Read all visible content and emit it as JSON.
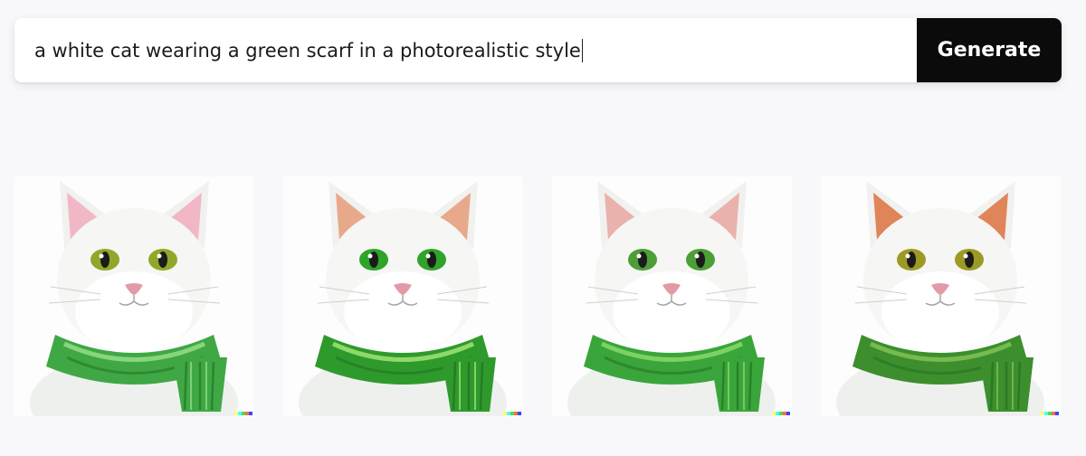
{
  "prompt": {
    "value": "a white cat wearing a green scarf in a photorealistic style"
  },
  "generate_label": "Generate",
  "watermark_colors": [
    "#ffff66",
    "#42ffff",
    "#51da4c",
    "#ff6e3c",
    "#3c46ff"
  ],
  "results": [
    {
      "name": "result-image-1",
      "scarf": "#3fa845",
      "scarf_light": "#9be08f",
      "ear": "#f2b7c5",
      "eye": "#8fa82a"
    },
    {
      "name": "result-image-2",
      "scarf": "#2f9a2c",
      "scarf_light": "#a6e97a",
      "ear": "#e8a98a",
      "eye": "#2fa32a"
    },
    {
      "name": "result-image-3",
      "scarf": "#3aa53a",
      "scarf_light": "#8fdc6e",
      "ear": "#e9b2ac",
      "eye": "#4c9e36"
    },
    {
      "name": "result-image-4",
      "scarf": "#3c8f2c",
      "scarf_light": "#86c45a",
      "ear": "#e0845a",
      "eye": "#9c9a24"
    }
  ]
}
